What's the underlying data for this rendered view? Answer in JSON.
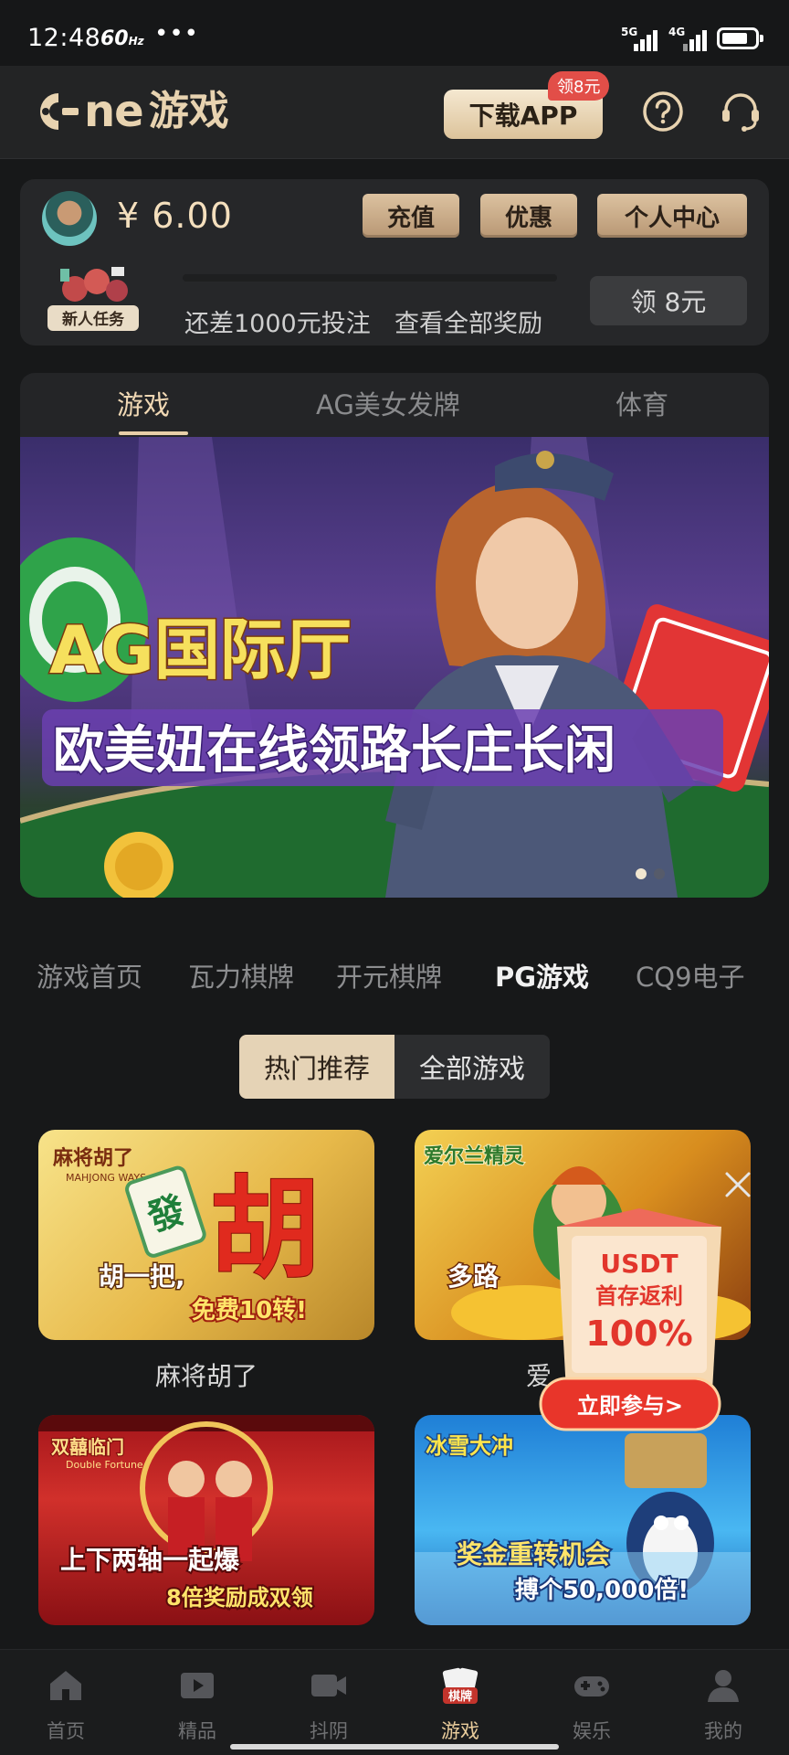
{
  "status_bar": {
    "time": "12:48",
    "refresh_rate": "60",
    "refresh_unit": "Hz",
    "more": "•••",
    "signal_1_label": "5G",
    "signal_2_label": "4G",
    "battery_level": 0.8
  },
  "header": {
    "brand": "ne",
    "brand_sub": "游戏",
    "download_label": "下载APP",
    "download_badge": "领8元",
    "accent_color": "#e8d3b0"
  },
  "account": {
    "balance": "¥ 6.00",
    "recharge_label": "充值",
    "promo_label": "优惠",
    "profile_label": "个人中心",
    "task_badge": "新人任务",
    "task_text": "还差1000元投注",
    "task_link": "查看全部奖励",
    "claim_label": "领 8元",
    "task_progress": 0.0
  },
  "tabs": {
    "items": [
      "游戏",
      "AG美女发牌",
      "体育"
    ],
    "active": 0
  },
  "banner": {
    "headline": "AG国际厅",
    "subline": "欧美妞在线领路长庄长闲",
    "slide_count": 2,
    "active_slide": 0
  },
  "providers": {
    "items": [
      "游戏首页",
      "瓦力棋牌",
      "开元棋牌",
      "PG游戏",
      "CQ9电子"
    ],
    "active": 3
  },
  "segment": {
    "hot": "热门推荐",
    "all": "全部游戏"
  },
  "games": [
    {
      "name": "麻将胡了",
      "logo": "麻将胡了",
      "logo_en": "MAHJONG WAYS",
      "big_char": "胡",
      "tile": "發",
      "tagline": "胡一把,",
      "sub": "免费10转!"
    },
    {
      "name": "爱",
      "logo": "爱尔兰精灵",
      "tagline": "多路"
    },
    {
      "logo": "双囍临门",
      "logo_en": "Double Fortune",
      "tagline": "上下两轴一起爆",
      "sub": "8倍奖励成双领"
    },
    {
      "logo": "冰雪大冲",
      "tagline": "奖金重转机会",
      "sub": "搏个50,000倍!"
    }
  ],
  "promo": {
    "title": "USDT",
    "line2": "首存返利",
    "line3": "100%",
    "cta": "立即参与>"
  },
  "bottom_nav": {
    "items": [
      {
        "label": "首页",
        "icon": "home-icon"
      },
      {
        "label": "精品",
        "icon": "video-play-icon"
      },
      {
        "label": "抖阴",
        "icon": "camera-icon"
      },
      {
        "label": "游戏",
        "icon": "cards-icon",
        "badge": "棋牌"
      },
      {
        "label": "娱乐",
        "icon": "gamepad-icon"
      },
      {
        "label": "我的",
        "icon": "user-icon"
      }
    ],
    "active": 3
  }
}
